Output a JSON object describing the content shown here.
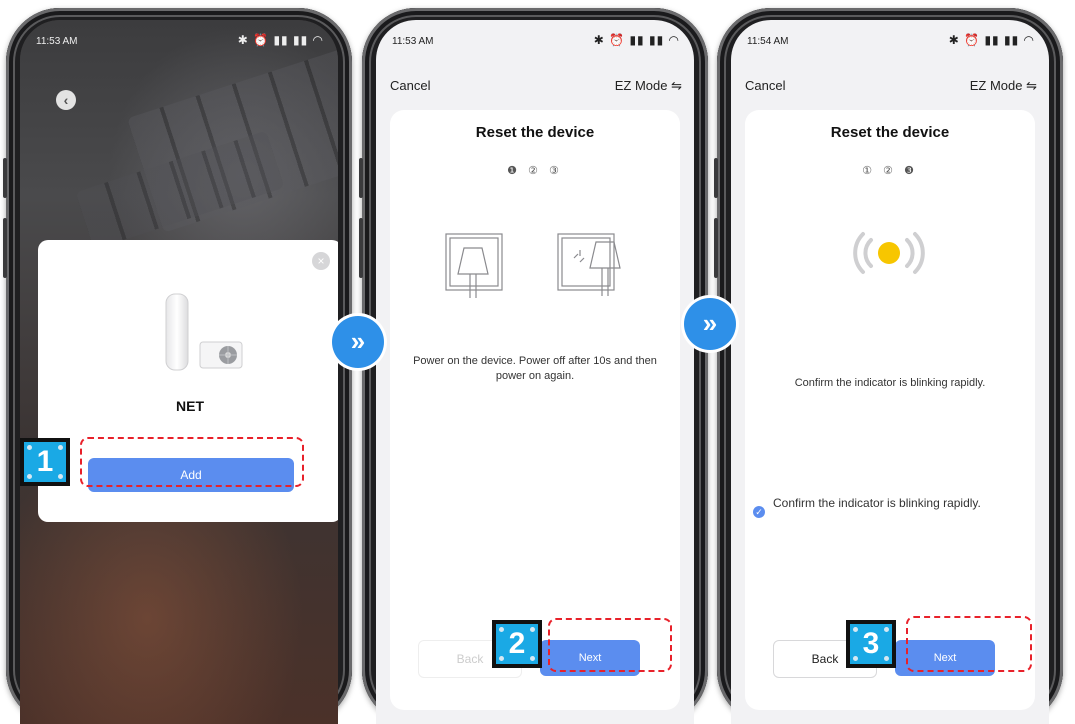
{
  "screens": [
    {
      "time": "11:53 AM",
      "status_icons": "✱ ⏰ ▮▮ ▮▮ ◠",
      "back_icon": "chevron-left-icon",
      "card": {
        "device_name": "NET",
        "add_label": "Add"
      }
    },
    {
      "time": "11:53 AM",
      "status_icons": "✱ ⏰ ▮▮ ▮▮ ◠",
      "cancel_label": "Cancel",
      "mode_label": "EZ Mode ⇋",
      "title": "Reset the device",
      "steps": "❶ ② ③",
      "description": "Power on the device. Power off after 10s and then power on again.",
      "back_label": "Back",
      "next_label": "Next"
    },
    {
      "time": "11:54 AM",
      "status_icons": "✱ ⏰ ▮▮ ▮▮ ◠",
      "cancel_label": "Cancel",
      "mode_label": "EZ Mode ⇋",
      "title": "Reset the device",
      "steps": "① ② ❸",
      "description": "Confirm the indicator is blinking rapidly.",
      "confirm_label": "Confirm the indicator is blinking rapidly.",
      "back_label": "Back",
      "next_label": "Next"
    }
  ],
  "badges": [
    "1",
    "2",
    "3"
  ],
  "arrow_glyph": "»",
  "colors": {
    "accent": "#5b8def",
    "arrow": "#2e90e8",
    "callout": "#e8212a",
    "badge": "#1aa9e5"
  }
}
